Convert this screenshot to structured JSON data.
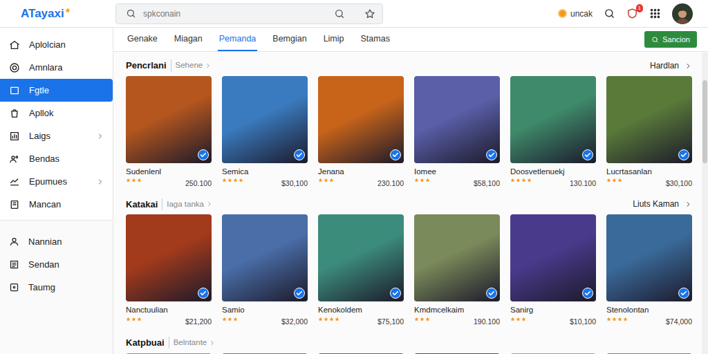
{
  "app": {
    "logo": "ATayaxi"
  },
  "search": {
    "placeholder": "spkconain"
  },
  "account": {
    "coins_label": "uncak",
    "notification_count": "1"
  },
  "sidebar": {
    "items": [
      {
        "label": "Aplolcian",
        "selected": false,
        "has_submenu": false
      },
      {
        "label": "Amnlara",
        "selected": false,
        "has_submenu": false
      },
      {
        "label": "Fgtle",
        "selected": true,
        "has_submenu": false
      },
      {
        "label": "Apllok",
        "selected": false,
        "has_submenu": false
      },
      {
        "label": "Laigs",
        "selected": false,
        "has_submenu": true
      },
      {
        "label": "Bendas",
        "selected": false,
        "has_submenu": false
      },
      {
        "label": "Epumues",
        "selected": false,
        "has_submenu": true
      },
      {
        "label": "Mancan",
        "selected": false,
        "has_submenu": false
      }
    ],
    "secondary_items": [
      {
        "label": "Nannian",
        "selected": false
      },
      {
        "label": "Sendan",
        "selected": false
      },
      {
        "label": "Taumg",
        "selected": false
      }
    ]
  },
  "tabs": [
    {
      "label": "Genake",
      "selected": false
    },
    {
      "label": "Miagan",
      "selected": false
    },
    {
      "label": "Pemanda",
      "selected": true
    },
    {
      "label": "Bemgian",
      "selected": false
    },
    {
      "label": "Limip",
      "selected": false
    },
    {
      "label": "Stamas",
      "selected": false
    }
  ],
  "action_button": {
    "label": "Sancion"
  },
  "sections": [
    {
      "title": "Pencrlani",
      "subtitle": "Sehene",
      "link": "Hardlan",
      "items": [
        {
          "name": "Sudenlenl",
          "stars": 3,
          "price": "250.100",
          "verified": true,
          "color": "#b4561e"
        },
        {
          "name": "Semica",
          "stars": 4,
          "price": "$30,100",
          "verified": true,
          "color": "#3a7bbf"
        },
        {
          "name": "Jenana",
          "stars": 3,
          "price": "230.100",
          "verified": true,
          "color": "#c8641a"
        },
        {
          "name": "Iomee",
          "stars": 3,
          "price": "$58,100",
          "verified": true,
          "color": "#5a5fa8"
        },
        {
          "name": "Doosvetlenuekj",
          "stars": 4,
          "price": "130.100",
          "verified": true,
          "color": "#3f8a6b"
        },
        {
          "name": "Lucrtasanlan",
          "stars": 3,
          "price": "$30,100",
          "verified": true,
          "color": "#5a7a3a"
        }
      ]
    },
    {
      "title": "Katakai",
      "subtitle": "Iaga tanka",
      "link": "Liuts Kaman",
      "items": [
        {
          "name": "Nanctuulian",
          "stars": 3,
          "price": "$21,200",
          "verified": true,
          "color": "#a23a1c"
        },
        {
          "name": "Samio",
          "stars": 3,
          "price": "$32,000",
          "verified": true,
          "color": "#4a6ea8"
        },
        {
          "name": "Kenokoldem",
          "stars": 4,
          "price": "$75,100",
          "verified": true,
          "color": "#3c8c7c"
        },
        {
          "name": "Kmdmcelkaim",
          "stars": 3,
          "price": "190.100",
          "verified": true,
          "color": "#7a8a5a"
        },
        {
          "name": "Sanirg",
          "stars": 3,
          "price": "$10,100",
          "verified": true,
          "color": "#4a3a8c"
        },
        {
          "name": "Stenolontan",
          "stars": 4,
          "price": "$74,000",
          "verified": true,
          "color": "#3a6a9a"
        }
      ]
    },
    {
      "title": "Katpbuai",
      "subtitle": "Belntante",
      "link": null,
      "items": [
        {
          "color": "#d8762a"
        },
        {
          "color": "#c45a1a"
        },
        {
          "color": "#8a3ac0"
        },
        {
          "color": "#3a4a8a"
        },
        {
          "color": "#c89a3a"
        },
        {
          "color": "#d0602a"
        }
      ]
    }
  ]
}
